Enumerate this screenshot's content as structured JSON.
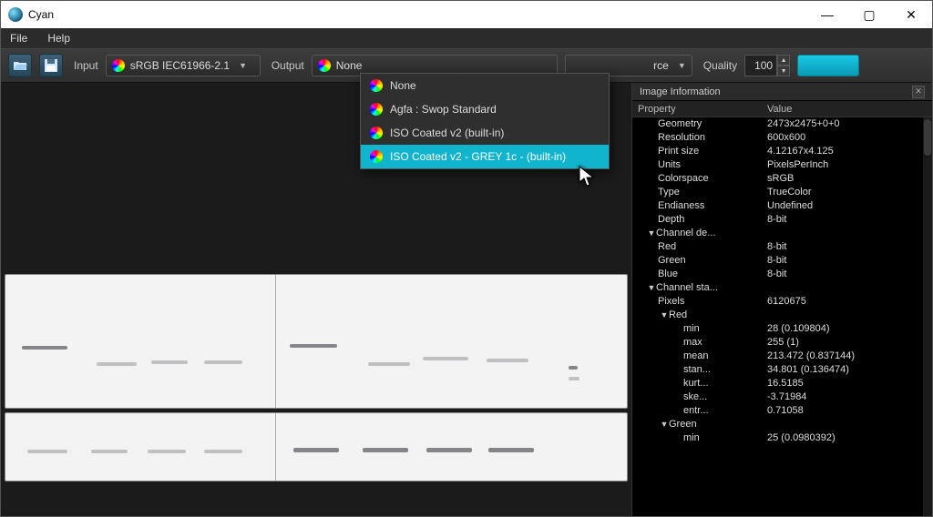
{
  "window": {
    "title": "Cyan"
  },
  "menubar": {
    "file": "File",
    "help": "Help"
  },
  "toolbar": {
    "input_label": "Input",
    "input_value": "sRGB IEC61966-2.1",
    "output_label": "Output",
    "output_value": "None",
    "intent_value": "rce",
    "quality_label": "Quality",
    "quality_value": "100"
  },
  "output_dropdown": {
    "items": [
      {
        "label": "None"
      },
      {
        "label": "Agfa : Swop Standard"
      },
      {
        "label": "ISO Coated v2 (built-in)"
      },
      {
        "label": "ISO Coated v2 - GREY 1c - (built-in)"
      }
    ],
    "highlight_index": 3
  },
  "info_panel": {
    "title": "Image Information",
    "col_property": "Property",
    "col_value": "Value",
    "rows": [
      {
        "indent": 1,
        "k": "Geometry",
        "v": "2473x2475+0+0"
      },
      {
        "indent": 1,
        "k": "Resolution",
        "v": "600x600"
      },
      {
        "indent": 1,
        "k": "Print size",
        "v": "4.12167x4.125"
      },
      {
        "indent": 1,
        "k": "Units",
        "v": "PixelsPerInch"
      },
      {
        "indent": 1,
        "k": "Colorspace",
        "v": "sRGB"
      },
      {
        "indent": 1,
        "k": "Type",
        "v": "TrueColor"
      },
      {
        "indent": 1,
        "k": "Endianess",
        "v": "Undefined"
      },
      {
        "indent": 1,
        "k": "Depth",
        "v": "8-bit"
      },
      {
        "indent": 2,
        "tri": true,
        "k": "Channel de...",
        "v": ""
      },
      {
        "indent": 1,
        "k": "Red",
        "v": "8-bit"
      },
      {
        "indent": 1,
        "k": "Green",
        "v": "8-bit"
      },
      {
        "indent": 1,
        "k": "Blue",
        "v": "8-bit"
      },
      {
        "indent": 2,
        "tri": true,
        "k": "Channel sta...",
        "v": ""
      },
      {
        "indent": 1,
        "k": "Pixels",
        "v": "6120675"
      },
      {
        "indent": 3,
        "tri": true,
        "k": "Red",
        "v": ""
      },
      {
        "indent": 4,
        "k": "min",
        "v": "28  (0.109804)"
      },
      {
        "indent": 4,
        "k": "max",
        "v": "255 (1)"
      },
      {
        "indent": 4,
        "k": "mean",
        "v": "213.472 (0.837144)"
      },
      {
        "indent": 4,
        "k": "stan...",
        "v": "34.801 (0.136474)"
      },
      {
        "indent": 4,
        "k": "kurt...",
        "v": "16.5185"
      },
      {
        "indent": 4,
        "k": "ske...",
        "v": "-3.71984"
      },
      {
        "indent": 4,
        "k": "entr...",
        "v": "0.71058"
      },
      {
        "indent": 3,
        "tri": true,
        "k": "Green",
        "v": ""
      },
      {
        "indent": 4,
        "k": "min",
        "v": "25  (0.0980392)"
      }
    ]
  }
}
